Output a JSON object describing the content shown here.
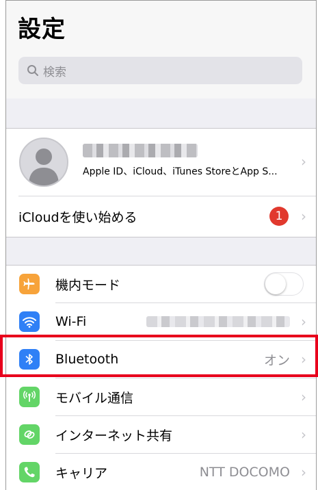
{
  "header": {
    "title": "設定",
    "search_placeholder": "検索"
  },
  "profile": {
    "subtitle": "Apple ID、iCloud、iTunes StoreとApp S..."
  },
  "icloud": {
    "label": "iCloudを使い始める",
    "badge": "1"
  },
  "settings": [
    {
      "label": "機内モード",
      "icon": "airplane-icon",
      "color": "#f7a33a",
      "toggle": false
    },
    {
      "label": "Wi-Fi",
      "icon": "wifi-icon",
      "color": "#2f80f6"
    },
    {
      "label": "Bluetooth",
      "icon": "bluetooth-icon",
      "color": "#2f80f6",
      "value": "オン"
    },
    {
      "label": "モバイル通信",
      "icon": "antenna-icon",
      "color": "#63d567"
    },
    {
      "label": "インターネット共有",
      "icon": "link-icon",
      "color": "#63d567"
    },
    {
      "label": "キャリア",
      "icon": "phone-icon",
      "color": "#63d567",
      "value": "NTT DOCOMO"
    }
  ],
  "highlight_color": "#e8001c"
}
